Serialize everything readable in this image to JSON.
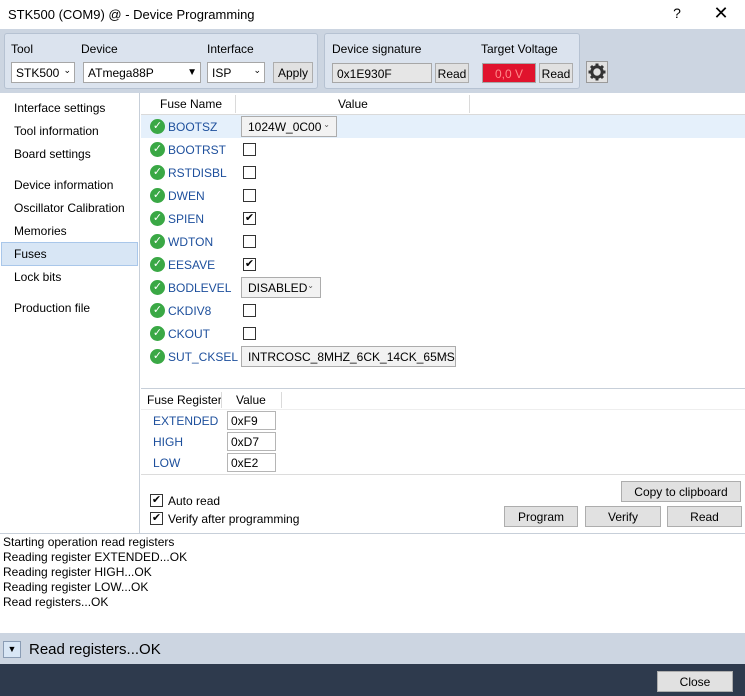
{
  "window": {
    "title": "STK500 (COM9) @  - Device Programming",
    "help_glyph": "?",
    "close_glyph": "✕"
  },
  "toolbar": {
    "tool_label": "Tool",
    "tool_value": "STK500",
    "device_label": "Device",
    "device_value": "ATmega88P",
    "interface_label": "Interface",
    "interface_value": "ISP",
    "apply_label": "Apply",
    "signature_label": "Device signature",
    "signature_value": "0x1E930F",
    "signature_read": "Read",
    "voltage_label": "Target Voltage",
    "voltage_value": "0,0 V",
    "voltage_read": "Read",
    "voltage_color": "#e0132d"
  },
  "sidebar": {
    "items": [
      {
        "label": "Interface settings"
      },
      {
        "label": "Tool information"
      },
      {
        "label": "Board settings"
      },
      {
        "label": "Device information"
      },
      {
        "label": "Oscillator Calibration"
      },
      {
        "label": "Memories"
      },
      {
        "label": "Fuses",
        "selected": true
      },
      {
        "label": "Lock bits"
      },
      {
        "label": "Production file"
      }
    ]
  },
  "fuses": {
    "col_name": "Fuse Name",
    "col_value": "Value",
    "rows": [
      {
        "name": "BOOTSZ",
        "type": "dropdown",
        "value": "1024W_0C00"
      },
      {
        "name": "BOOTRST",
        "type": "checkbox",
        "checked": false
      },
      {
        "name": "RSTDISBL",
        "type": "checkbox",
        "checked": false
      },
      {
        "name": "DWEN",
        "type": "checkbox",
        "checked": false
      },
      {
        "name": "SPIEN",
        "type": "checkbox",
        "checked": true
      },
      {
        "name": "WDTON",
        "type": "checkbox",
        "checked": false
      },
      {
        "name": "EESAVE",
        "type": "checkbox",
        "checked": true
      },
      {
        "name": "BODLEVEL",
        "type": "dropdown",
        "value": "DISABLED"
      },
      {
        "name": "CKDIV8",
        "type": "checkbox",
        "checked": false
      },
      {
        "name": "CKOUT",
        "type": "checkbox",
        "checked": false
      },
      {
        "name": "SUT_CKSEL",
        "type": "dropdown",
        "value": "INTRCOSC_8MHZ_6CK_14CK_65MS"
      }
    ]
  },
  "registers": {
    "col_name": "Fuse Register",
    "col_value": "Value",
    "rows": [
      {
        "name": "EXTENDED",
        "value": "0xF9"
      },
      {
        "name": "HIGH",
        "value": "0xD7"
      },
      {
        "name": "LOW",
        "value": "0xE2"
      }
    ]
  },
  "options": {
    "auto_read": "Auto read",
    "verify": "Verify after programming",
    "copy": "Copy to clipboard",
    "program": "Program",
    "verify_btn": "Verify",
    "read": "Read"
  },
  "log": {
    "lines": [
      "Starting operation read registers",
      "Reading register EXTENDED...OK",
      "Reading register HIGH...OK",
      "Reading register LOW...OK",
      "Read registers...OK"
    ]
  },
  "status": {
    "text": "Read registers...OK",
    "close": "Close"
  }
}
